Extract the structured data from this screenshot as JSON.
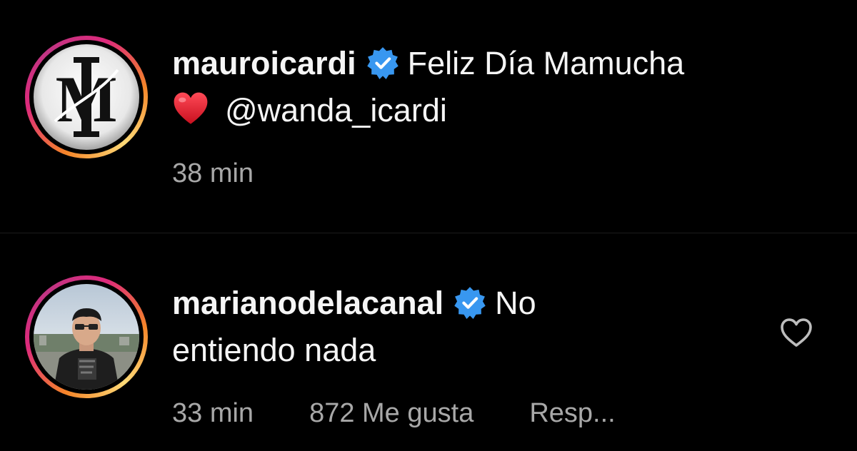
{
  "comments": [
    {
      "username": "mauroicardi",
      "text_line1": "Feliz Día Mamucha",
      "mention": "@wanda_icardi",
      "time": "38 min"
    },
    {
      "username": "marianodelacanal",
      "text_line1": "No",
      "text_line2": "entiendo nada",
      "time": "33 min",
      "likes": "872 Me gusta",
      "reply": "Resp..."
    }
  ],
  "icons": {
    "verified": "verified-badge-icon",
    "heart_emoji": "red-heart-emoji",
    "like": "heart-outline-icon"
  },
  "colors": {
    "background": "#000000",
    "text": "#f5f5f5",
    "meta_text": "#a8a8a8",
    "verified_blue": "#3897f0",
    "heart_red": "#e0162b"
  }
}
